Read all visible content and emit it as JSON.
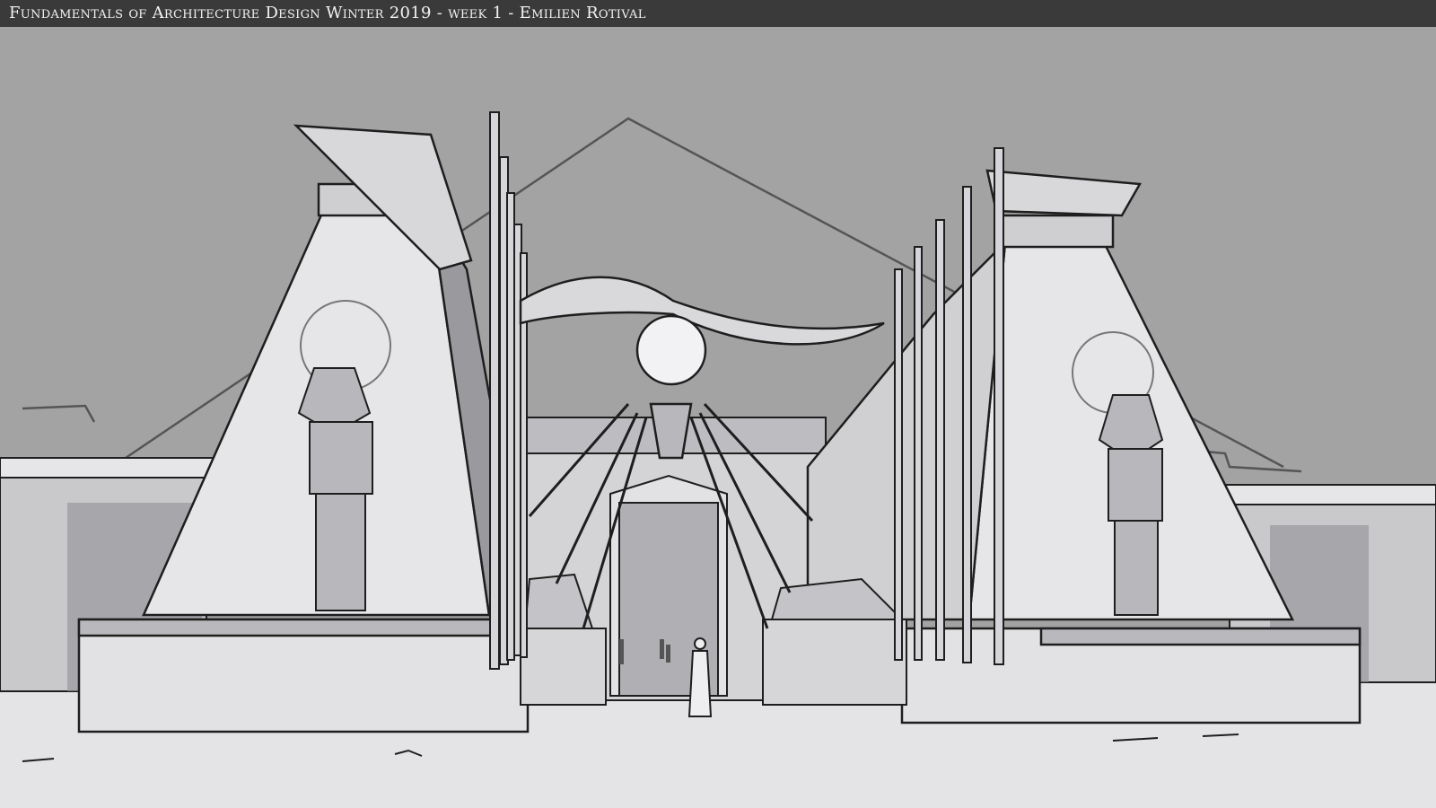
{
  "header": {
    "title": "Fundamentals of Architecture Design Winter 2019 - week 1 - Emilien Rotival"
  },
  "artwork": {
    "colors": {
      "sky": "#a3a3a3",
      "stone_light": "#e6e6e8",
      "stone_mid": "#c9c9cc",
      "stone_shadow": "#8f8f94",
      "ground": "#e4e4e6",
      "ink": "#1e1e1e"
    }
  }
}
